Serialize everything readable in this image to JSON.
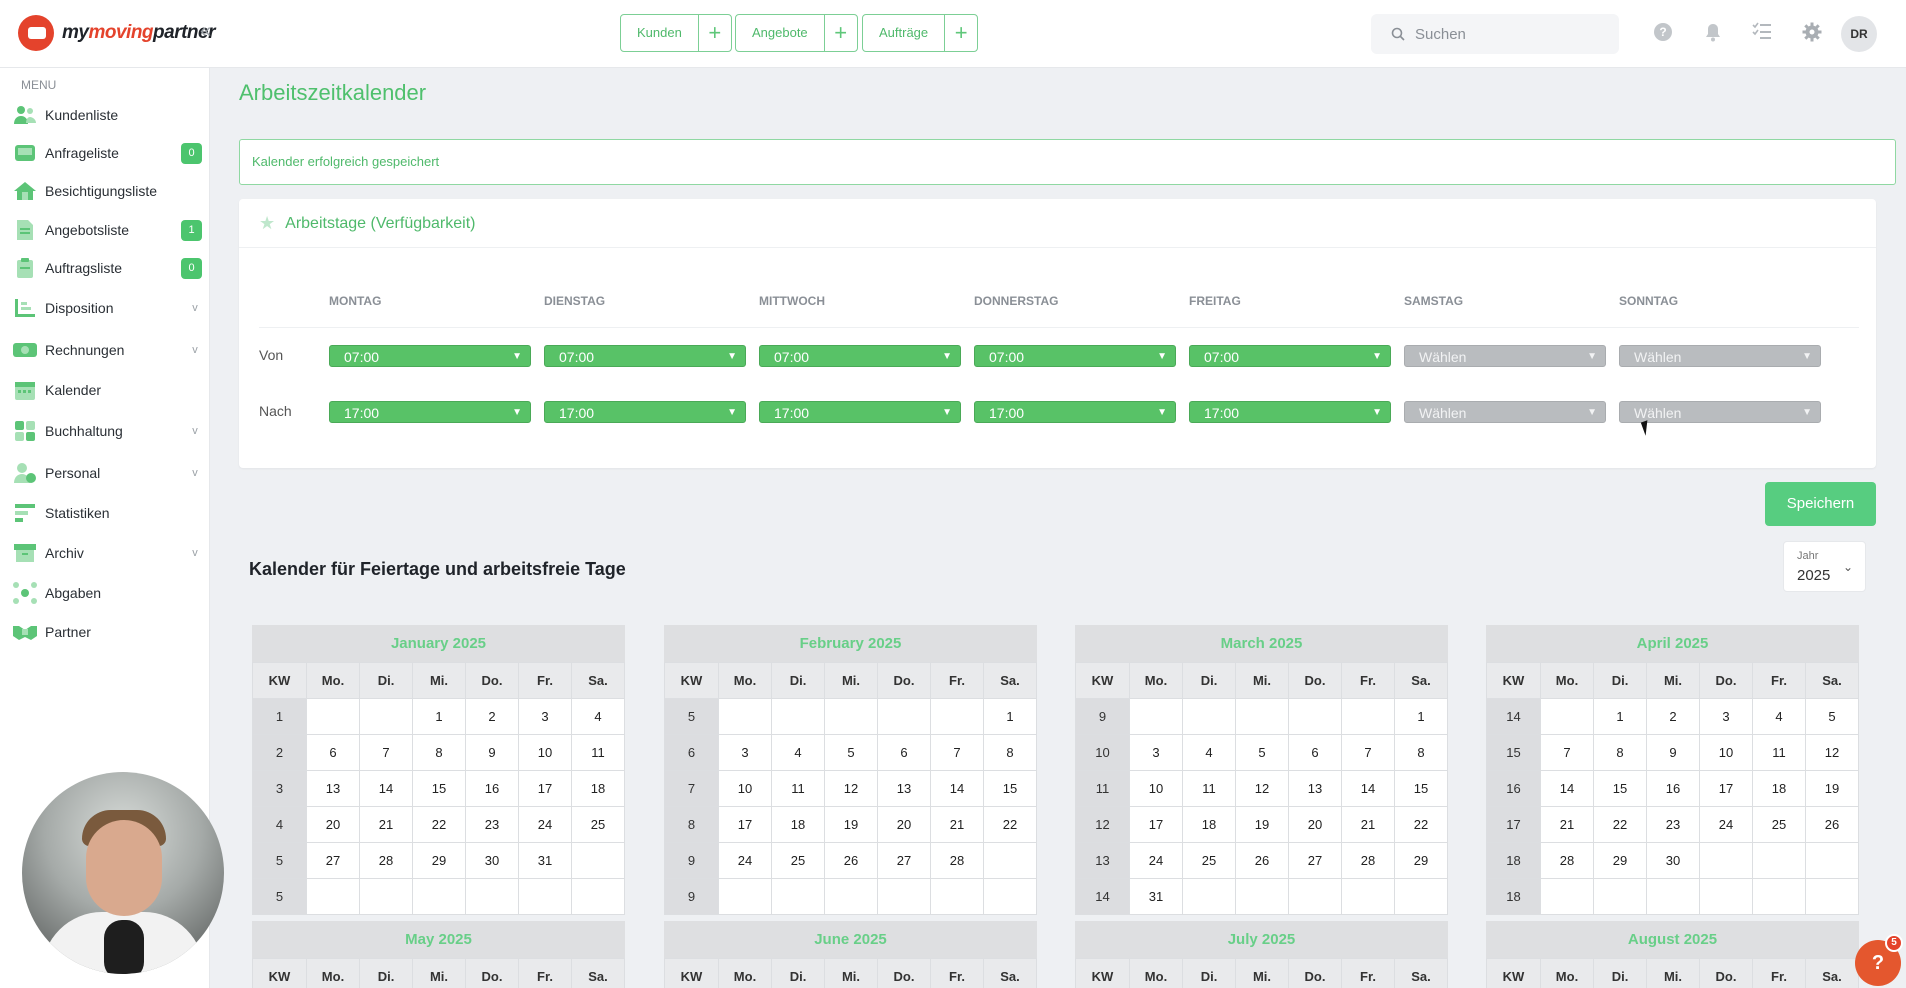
{
  "brand": {
    "name_a": "my",
    "name_b": "moving",
    "name_c": "partner"
  },
  "topnav": [
    {
      "label": "Kunden"
    },
    {
      "label": "Angebote"
    },
    {
      "label": "Aufträge"
    }
  ],
  "search": {
    "placeholder": "Suchen"
  },
  "user": {
    "initials": "DR"
  },
  "sidebar": {
    "header": "MENU",
    "items": [
      {
        "label": "Kundenliste",
        "icon": "users-icon"
      },
      {
        "label": "Anfrageliste",
        "icon": "inbox-icon",
        "badge": "0"
      },
      {
        "label": "Besichtigungsliste",
        "icon": "house-icon"
      },
      {
        "label": "Angebotsliste",
        "icon": "document-icon",
        "badge": "1"
      },
      {
        "label": "Auftragsliste",
        "icon": "clipboard-icon",
        "badge": "0"
      },
      {
        "label": "Disposition",
        "icon": "chart-icon",
        "chevron": "v"
      },
      {
        "label": "Rechnungen",
        "icon": "money-icon",
        "chevron": "v"
      },
      {
        "label": "Kalender",
        "icon": "calendar-icon"
      },
      {
        "label": "Buchhaltung",
        "icon": "grid-icon",
        "chevron": "v"
      },
      {
        "label": "Personal",
        "icon": "person-icon",
        "chevron": "v"
      },
      {
        "label": "Statistiken",
        "icon": "bars-icon"
      },
      {
        "label": "Archiv",
        "icon": "archive-icon",
        "chevron": "v"
      },
      {
        "label": "Abgaben",
        "icon": "network-icon"
      },
      {
        "label": "Partner",
        "icon": "handshake-icon"
      }
    ]
  },
  "main": {
    "title": "Arbeitszeitkalender",
    "alert": "Kalender erfolgreich gespeichert",
    "card_title": "Arbeitstage (Verfügbarkeit)",
    "days": [
      "MONTAG",
      "DIENSTAG",
      "MITTWOCH",
      "DONNERSTAG",
      "FREITAG",
      "SAMSTAG",
      "SONNTAG"
    ],
    "row_from": "Von",
    "row_to": "Nach",
    "from": [
      "07:00",
      "07:00",
      "07:00",
      "07:00",
      "07:00",
      "Wählen",
      "Wählen"
    ],
    "to": [
      "17:00",
      "17:00",
      "17:00",
      "17:00",
      "17:00",
      "Wählen",
      "Wählen"
    ],
    "save_label": "Speichern",
    "holiday_title": "Kalender für Feiertage und arbeitsfreie Tage",
    "year_label": "Jahr",
    "year_value": "2025"
  },
  "weekday_headers": [
    "KW",
    "Mo.",
    "Di.",
    "Mi.",
    "Do.",
    "Fr.",
    "Sa."
  ],
  "months": [
    {
      "title": "January 2025",
      "weeks": [
        [
          "1",
          "",
          "",
          "1",
          "2",
          "3",
          "4"
        ],
        [
          "2",
          "6",
          "7",
          "8",
          "9",
          "10",
          "11"
        ],
        [
          "3",
          "13",
          "14",
          "15",
          "16",
          "17",
          "18"
        ],
        [
          "4",
          "20",
          "21",
          "22",
          "23",
          "24",
          "25"
        ],
        [
          "5",
          "27",
          "28",
          "29",
          "30",
          "31",
          ""
        ],
        [
          "5",
          "",
          "",
          "",
          "",
          "",
          ""
        ]
      ]
    },
    {
      "title": "February 2025",
      "weeks": [
        [
          "5",
          "",
          "",
          "",
          "",
          "",
          "1"
        ],
        [
          "6",
          "3",
          "4",
          "5",
          "6",
          "7",
          "8"
        ],
        [
          "7",
          "10",
          "11",
          "12",
          "13",
          "14",
          "15"
        ],
        [
          "8",
          "17",
          "18",
          "19",
          "20",
          "21",
          "22"
        ],
        [
          "9",
          "24",
          "25",
          "26",
          "27",
          "28",
          ""
        ],
        [
          "9",
          "",
          "",
          "",
          "",
          "",
          ""
        ]
      ]
    },
    {
      "title": "March 2025",
      "weeks": [
        [
          "9",
          "",
          "",
          "",
          "",
          "",
          "1"
        ],
        [
          "10",
          "3",
          "4",
          "5",
          "6",
          "7",
          "8"
        ],
        [
          "11",
          "10",
          "11",
          "12",
          "13",
          "14",
          "15"
        ],
        [
          "12",
          "17",
          "18",
          "19",
          "20",
          "21",
          "22"
        ],
        [
          "13",
          "24",
          "25",
          "26",
          "27",
          "28",
          "29"
        ],
        [
          "14",
          "31",
          "",
          "",
          "",
          "",
          ""
        ]
      ]
    },
    {
      "title": "April 2025",
      "weeks": [
        [
          "14",
          "",
          "1",
          "2",
          "3",
          "4",
          "5"
        ],
        [
          "15",
          "7",
          "8",
          "9",
          "10",
          "11",
          "12"
        ],
        [
          "16",
          "14",
          "15",
          "16",
          "17",
          "18",
          "19"
        ],
        [
          "17",
          "21",
          "22",
          "23",
          "24",
          "25",
          "26"
        ],
        [
          "18",
          "28",
          "29",
          "30",
          "",
          "",
          ""
        ],
        [
          "18",
          "",
          "",
          "",
          "",
          "",
          ""
        ]
      ]
    },
    {
      "title": "May 2025",
      "weeks": []
    },
    {
      "title": "June 2025",
      "weeks": []
    },
    {
      "title": "July 2025",
      "weeks": []
    },
    {
      "title": "August 2025",
      "weeks": []
    }
  ],
  "help": {
    "symbol": "?",
    "count": "5"
  },
  "colors": {
    "accent": "#4fc06d",
    "badge": "#4cc56e",
    "help": "#e4572e"
  }
}
